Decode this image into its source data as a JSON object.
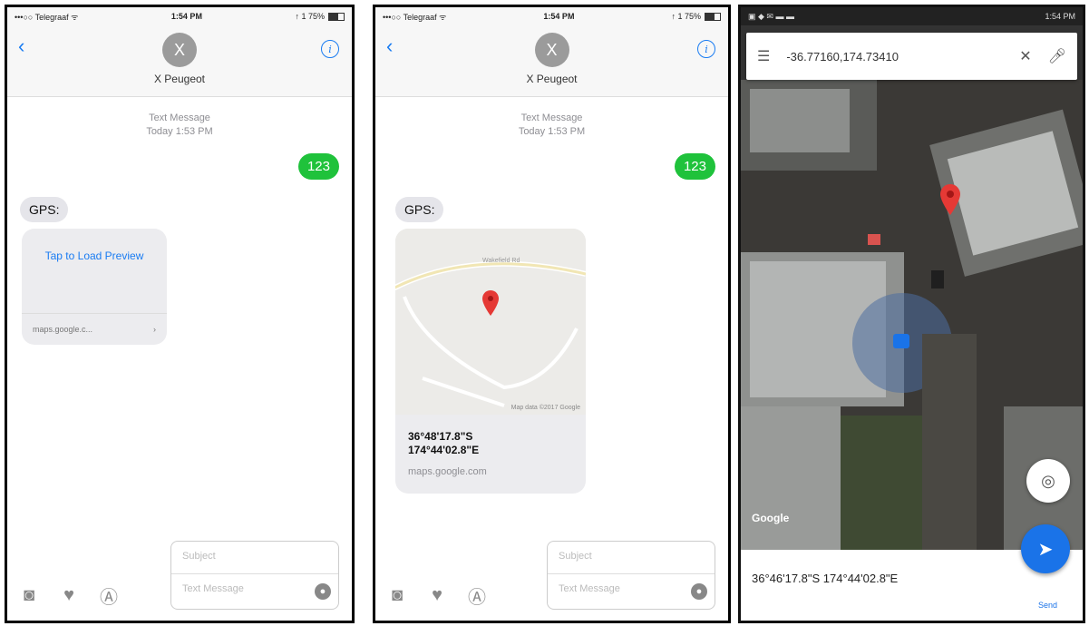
{
  "colors": {
    "ios_blue": "#1a7cf2",
    "green_bubble": "#1fc23b",
    "map_blue": "#1a73e8",
    "pin_red": "#e53935"
  },
  "status": {
    "carrier": "•••○○ Telegraaf ᯤ",
    "time": "1:54 PM",
    "battery": "↑ 1 75%"
  },
  "messages": {
    "contact_initial": "X",
    "contact_name": "X Peugeot",
    "thread_label": "Text Message",
    "thread_time": "Today 1:53 PM",
    "outgoing": "123",
    "incoming": "GPS:",
    "preview_tap": "Tap to Load Preview",
    "preview_link": "maps.google.c...",
    "map_card_coords_1": "36°48'17.8\"S",
    "map_card_coords_2": "174°44'02.8\"E",
    "map_card_host": "maps.google.com",
    "map_road_1": "Wakefield Rd",
    "map_copyright": "Map data ©2017 Google",
    "compose_subject": "Subject",
    "compose_placeholder": "Text Message"
  },
  "maps": {
    "status_left": "▣ ◆ ✉ ▬ ▬",
    "status_time": "1:54 PM",
    "query": "-36.77160,174.73410",
    "google_label": "Google",
    "coords": "36°46'17.8\"S 174°44'02.8\"E",
    "go_label": "Send"
  },
  "icons": [
    "back-chevron-icon",
    "info-icon",
    "camera-icon",
    "heart-hands-icon",
    "app-store-icon",
    "microphone-icon",
    "menu-icon",
    "close-icon",
    "map-pin-icon",
    "location-icon",
    "directions-icon"
  ]
}
